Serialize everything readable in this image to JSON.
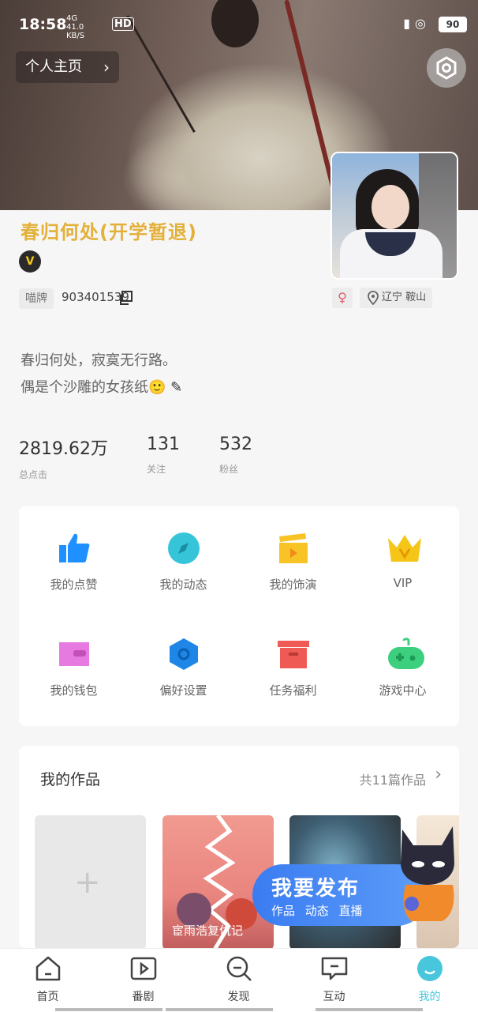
{
  "status_bar": {
    "time": "18:58",
    "network": "4G",
    "speed": "41.0",
    "speed_unit": "KB/S",
    "hd": "HD",
    "battery": "90"
  },
  "header": {
    "homepage_label": "个人主页",
    "settings_icon": "hexagon-gear-icon"
  },
  "profile": {
    "nickname": "春归何处(开学暂退)",
    "vip_badge": "V",
    "id_label": "喵牌",
    "id_value": "903401539",
    "gender_symbol": "♀",
    "location": "辽宁 鞍山",
    "bio_line1": "春归何处，寂寞无行路。",
    "bio_line2": "偶是个沙雕的女孩纸🙂",
    "stats": [
      {
        "value": "2819.62万",
        "label": "总点击"
      },
      {
        "value": "131",
        "label": "关注"
      },
      {
        "value": "532",
        "label": "粉丝"
      }
    ]
  },
  "features": [
    {
      "label": "我的点赞",
      "icon": "thumbs-up-icon",
      "color": "#1e90ff"
    },
    {
      "label": "我的动态",
      "icon": "compass-icon",
      "color": "#36c5d8"
    },
    {
      "label": "我的饰演",
      "icon": "clapperboard-icon",
      "color": "#f7c325"
    },
    {
      "label": "VIP",
      "icon": "crown-icon",
      "color": "#f5b800"
    },
    {
      "label": "我的钱包",
      "icon": "wallet-icon",
      "color": "#e67ae0"
    },
    {
      "label": "偏好设置",
      "icon": "hexagon-settings-icon",
      "color": "#1e86e6"
    },
    {
      "label": "任务福利",
      "icon": "gift-box-icon",
      "color": "#f05a55"
    },
    {
      "label": "游戏中心",
      "icon": "gamepad-icon",
      "color": "#3ccf7e"
    }
  ],
  "works": {
    "title": "我的作品",
    "count_text": "共11篇作品",
    "tile1_caption": "宦雨浩复仇记"
  },
  "publish": {
    "title": "我要发布",
    "sub": "作品 动态 直播"
  },
  "bottom_nav": [
    {
      "label": "首页",
      "icon": "home-icon"
    },
    {
      "label": "番剧",
      "icon": "play-icon"
    },
    {
      "label": "发现",
      "icon": "search-icon"
    },
    {
      "label": "互动",
      "icon": "message-icon"
    },
    {
      "label": "我的",
      "icon": "profile-bubble-icon"
    }
  ]
}
